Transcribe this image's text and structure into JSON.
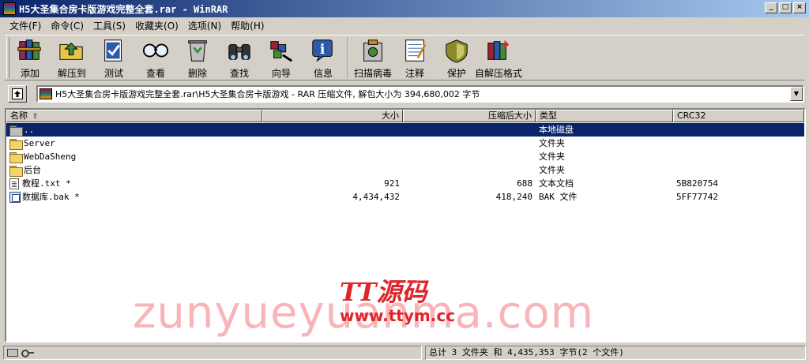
{
  "window": {
    "title": "H5大圣集合房卡版游戏完整全套.rar - WinRAR",
    "controls": [
      "_",
      "□",
      "×"
    ]
  },
  "menu": [
    "文件(F)",
    "命令(C)",
    "工具(S)",
    "收藏夹(O)",
    "选项(N)",
    "帮助(H)"
  ],
  "toolbar": [
    {
      "label": "添加",
      "icon": "books-icon",
      "color": "#8a2c5a"
    },
    {
      "label": "解压到",
      "icon": "folder-extract-icon",
      "color": "#c98a1a"
    },
    {
      "label": "测试",
      "icon": "check-clipboard-icon",
      "color": "#2d5aa8"
    },
    {
      "label": "查看",
      "icon": "glasses-icon",
      "color": "#555555"
    },
    {
      "label": "删除",
      "icon": "recycle-bin-icon",
      "color": "#3f8a3b"
    },
    {
      "label": "查找",
      "icon": "binoculars-icon",
      "color": "#333333"
    },
    {
      "label": "向导",
      "icon": "wand-icon",
      "color": "#8a2c5a"
    },
    {
      "label": "信息",
      "icon": "info-icon",
      "color": "#2d5aa8"
    },
    {
      "label": "扫描病毒",
      "icon": "virus-scan-icon",
      "color": "#c98a1a"
    },
    {
      "label": "注释",
      "icon": "notepad-icon",
      "color": "#888888"
    },
    {
      "label": "保护",
      "icon": "shield-icon",
      "color": "#8a8a2c"
    },
    {
      "label": "自解压格式",
      "icon": "sfx-archive-icon",
      "color": "#3f8a3b"
    }
  ],
  "address": {
    "path": "H5大圣集合房卡版游戏完整全套.rar\\H5大圣集合房卡版游戏 - RAR 压缩文件, 解包大小为 394,680,002 字节"
  },
  "columns": [
    "名称",
    "大小",
    "压缩后大小",
    "类型",
    "CRC32"
  ],
  "rows": [
    {
      "name": "..",
      "size": "",
      "packed": "",
      "type": "本地磁盘",
      "crc": "",
      "icon": "up-folder-icon",
      "selected": true
    },
    {
      "name": "Server",
      "size": "",
      "packed": "",
      "type": "文件夹",
      "crc": "",
      "icon": "folder-icon",
      "selected": false
    },
    {
      "name": "WebDaSheng",
      "size": "",
      "packed": "",
      "type": "文件夹",
      "crc": "",
      "icon": "folder-icon",
      "selected": false
    },
    {
      "name": "后台",
      "size": "",
      "packed": "",
      "type": "文件夹",
      "crc": "",
      "icon": "folder-icon",
      "selected": false
    },
    {
      "name": "教程.txt *",
      "size": "921",
      "packed": "688",
      "type": "文本文档",
      "crc": "5B820754",
      "icon": "text-file-icon",
      "selected": false
    },
    {
      "name": "数据库.bak *",
      "size": "4,434,432",
      "packed": "418,240",
      "type": "BAK 文件",
      "crc": "5FF77742",
      "icon": "bak-file-icon",
      "selected": false
    }
  ],
  "watermark": {
    "text": "zunyueyuanma.com",
    "brand": "TT源码",
    "url": "www.ttym.cc"
  },
  "status": {
    "summary": "总计 3 文件夹 和 4,435,353 字节(2 个文件)"
  }
}
